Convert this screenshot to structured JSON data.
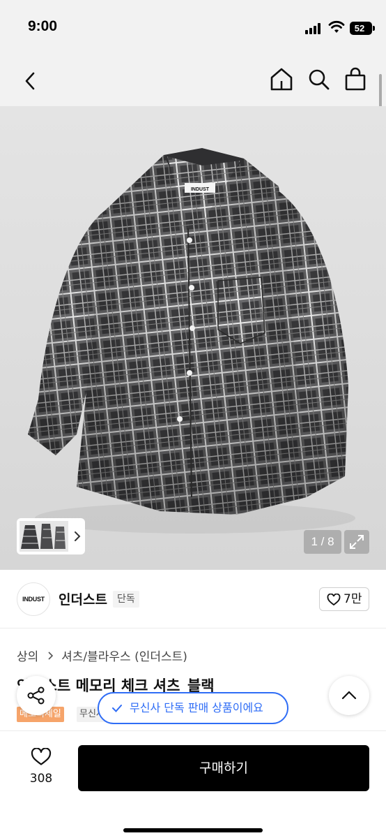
{
  "status_bar": {
    "time": "9:00",
    "battery": "52"
  },
  "nav": {
    "back_icon": "chevron-left-icon",
    "home_icon": "home-icon",
    "search_icon": "search-icon",
    "bag_icon": "shopping-bag-icon"
  },
  "gallery": {
    "image_description": "grey plaid flannel shirt",
    "label_text": "INDUST",
    "page_counter": "1 / 8",
    "expand_icon": "expand-icon",
    "thumb_next_icon": "chevron-right-icon"
  },
  "brand": {
    "logo_text": "INDUST",
    "name": "인더스트",
    "exclusive_badge": "단독",
    "like_count": "7만"
  },
  "breadcrumb": {
    "items": [
      "상의",
      "셔츠/블라우스 (인더스트)"
    ]
  },
  "product": {
    "title": "인더스트 메모리 체크 셔츠_블랙",
    "sale_badge": "메모리세일",
    "musinsa_badge": "무신사"
  },
  "toast": {
    "text": "무신사 단독 판매 상품이에요"
  },
  "bottom_bar": {
    "like_count": "308",
    "buy_label": "구매하기"
  },
  "colors": {
    "accent_blue": "#2f6df6",
    "sale_orange": "#f6a46a",
    "buy_button": "#000000"
  }
}
